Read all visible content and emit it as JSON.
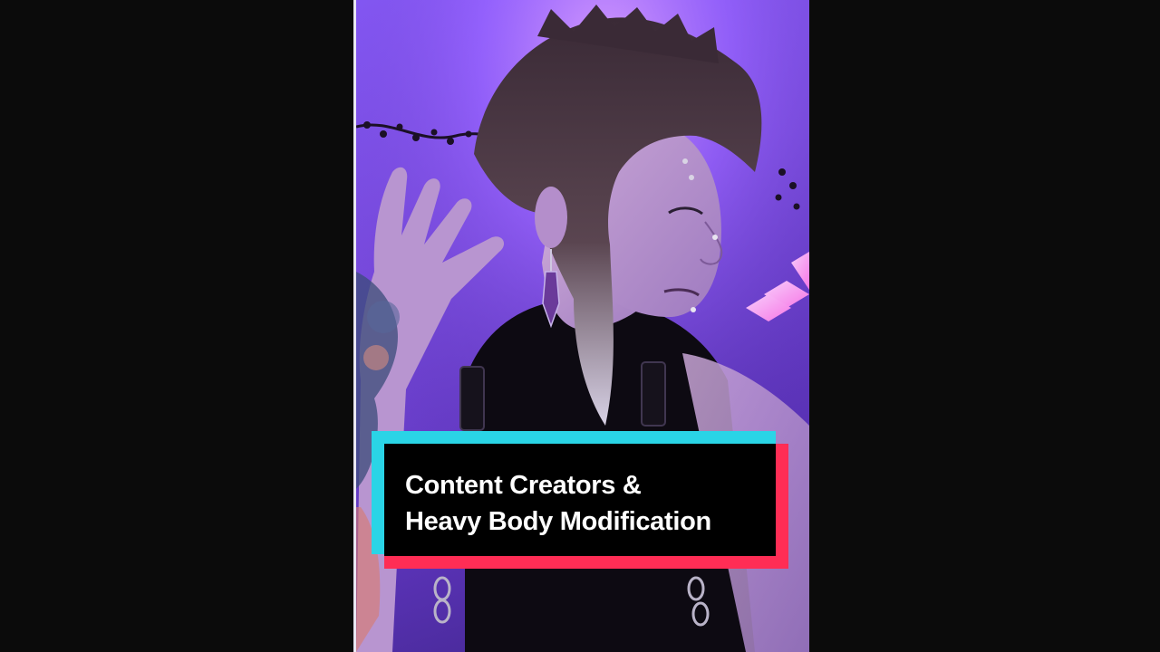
{
  "video": {
    "scene": "person-with-piercings-purple-lighting"
  },
  "caption": {
    "line1": "Content Creators &",
    "line2": "Heavy Body Modification"
  },
  "colors": {
    "background": "#0b0b0b",
    "accent_cyan": "#2ad4e6",
    "accent_red": "#ff2d55",
    "caption_bg": "#000000",
    "caption_text": "#ffffff",
    "lighting": "#8a5cff"
  }
}
